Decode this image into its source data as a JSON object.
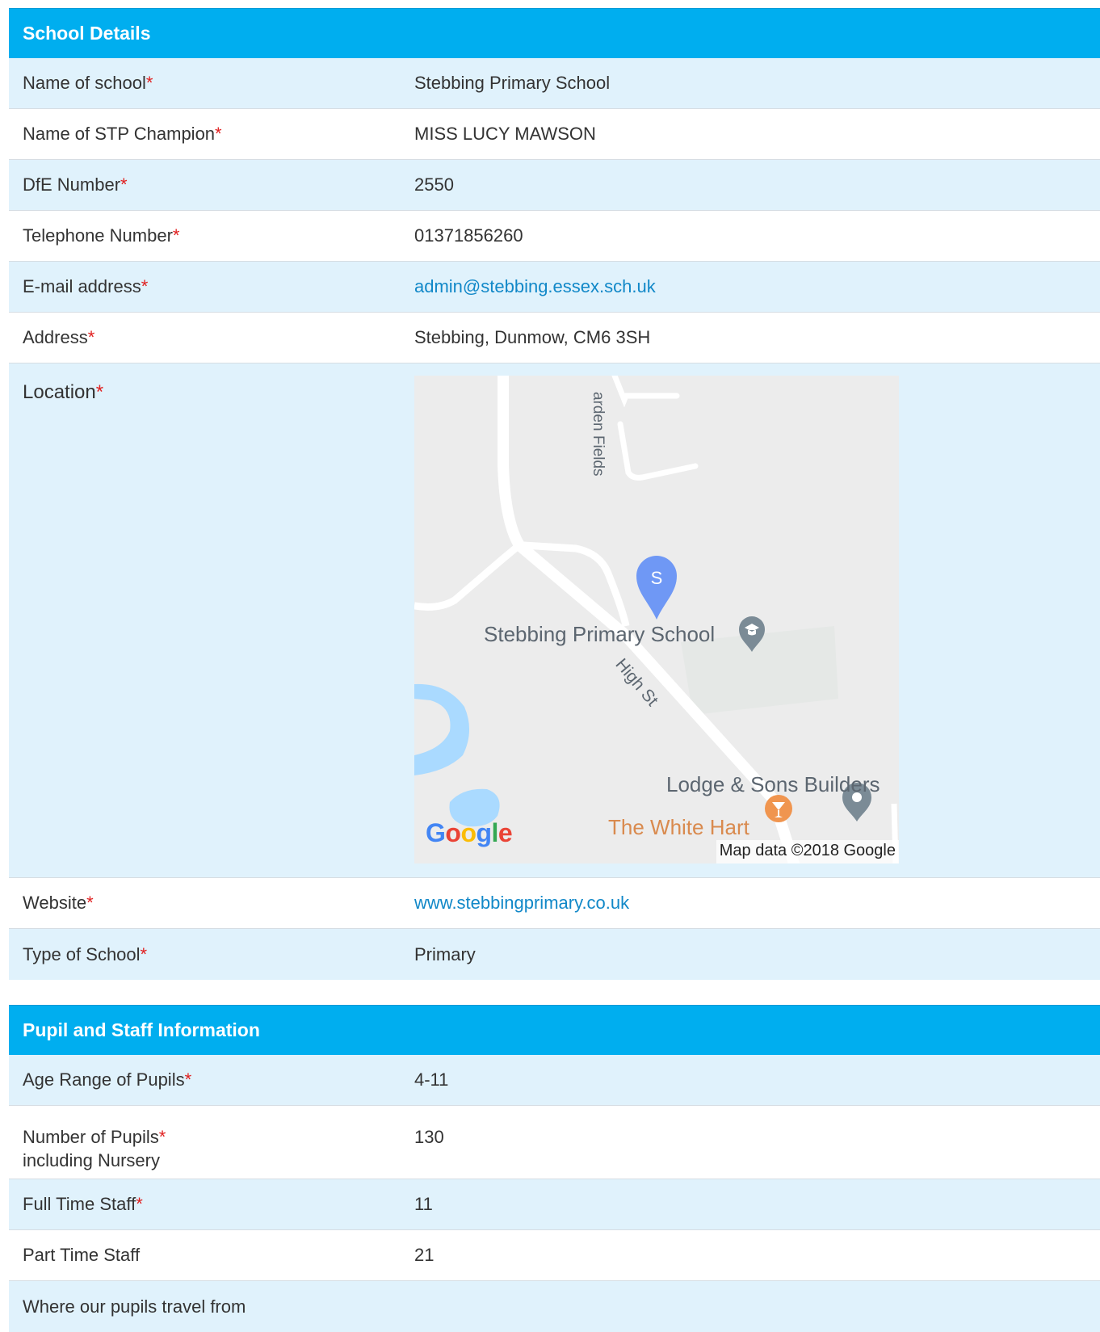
{
  "school_details": {
    "header": "School Details",
    "rows": [
      {
        "label": "Name of school",
        "required": "*",
        "value": "Stebbing Primary School"
      },
      {
        "label": "Name of STP Champion",
        "required": "*",
        "value": "MISS LUCY MAWSON"
      },
      {
        "label": "DfE Number",
        "required": "*",
        "value": "2550"
      },
      {
        "label": "Telephone Number",
        "required": "*",
        "value": "01371856260"
      },
      {
        "label": "E-mail address",
        "required": "*",
        "value": "admin@stebbing.essex.sch.uk"
      },
      {
        "label": "Address",
        "required": "*",
        "value": "Stebbing, Dunmow, CM6 3SH"
      }
    ],
    "location": {
      "label": "Location",
      "required": "*",
      "map": {
        "marker_letter": "S",
        "school_name": "Stebbing Primary School",
        "street_label": "High St",
        "road_label": "arden Fields",
        "business_label": "Lodge & Sons Builders",
        "pub_label": "The White Hart",
        "attribution": "Map data ©2018 Google",
        "logo_letters": [
          "G",
          "o",
          "o",
          "g",
          "l",
          "e"
        ],
        "marker_color": "#6f98f5",
        "water_color": "#aadaff",
        "road_color": "#ffffff",
        "land_color": "#ececec"
      }
    },
    "website": {
      "label": "Website",
      "required": "*",
      "value": "www.stebbingprimary.co.uk"
    },
    "type": {
      "label": "Type of School",
      "required": "*",
      "value": "Primary"
    }
  },
  "pupil_staff": {
    "header": "Pupil and Staff Information",
    "age_range": {
      "label": "Age Range of Pupils",
      "required": "*",
      "value": "4-11"
    },
    "num_pupils": {
      "label": "Number of Pupils",
      "required": "*",
      "sublabel": "including Nursery",
      "value": "130"
    },
    "full_time": {
      "label": "Full Time Staff",
      "required": "*",
      "value": "11"
    },
    "part_time": {
      "label": "Part Time Staff",
      "value": "21"
    },
    "travel": {
      "label": "Where our pupils travel from"
    }
  },
  "colors": {
    "header_bg": "#00aeef",
    "row_blue": "#e0f2fc",
    "required": "#e02020",
    "link": "#1188c8"
  }
}
